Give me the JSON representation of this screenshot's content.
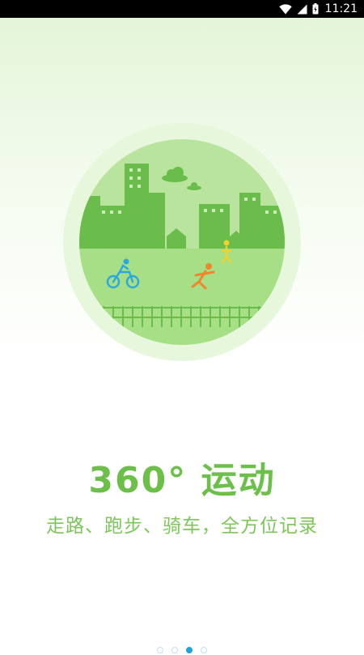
{
  "status_bar": {
    "time": "11:21",
    "icons": [
      "wifi-icon",
      "cellular-signal-icon",
      "battery-icon"
    ]
  },
  "onboarding": {
    "headline": "360° 运动",
    "subtitle": "走路、跑步、骑车，全方位记录",
    "illustration_icons": [
      "city-skyline-icon",
      "cyclist-icon",
      "runner-icon",
      "walker-icon",
      "cloud-icon"
    ],
    "page_count": 4,
    "current_page": 3
  },
  "colors": {
    "brand_green": "#6cc04a",
    "pager_active": "#1fa3d9"
  }
}
